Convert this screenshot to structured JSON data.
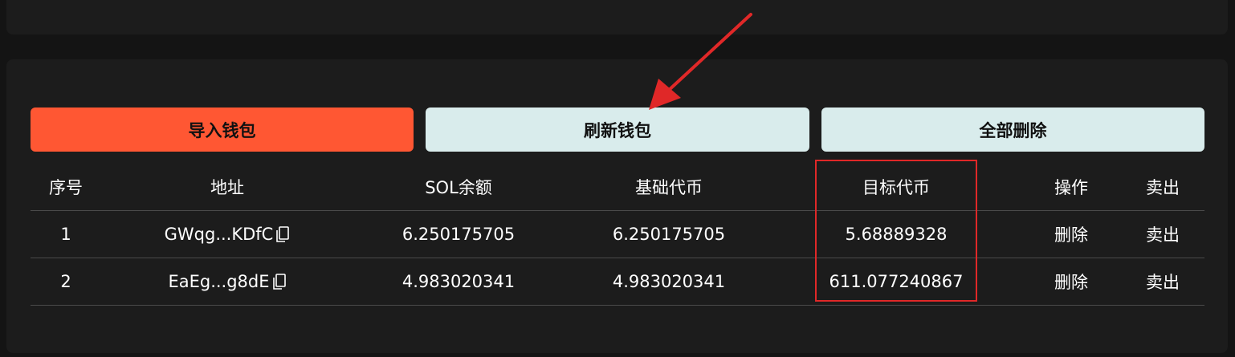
{
  "buttons": {
    "import": "导入钱包",
    "refresh": "刷新钱包",
    "delete_all": "全部删除"
  },
  "table": {
    "headers": {
      "index": "序号",
      "address": "地址",
      "sol_balance": "SOL余额",
      "base_token": "基础代币",
      "target_token": "目标代币",
      "operation": "操作",
      "sell": "卖出"
    },
    "rows": [
      {
        "index": "1",
        "address": "GWqg...KDfC",
        "sol_balance": "6.250175705",
        "base_token": "6.250175705",
        "target_token": "5.68889328",
        "delete": "删除",
        "sell": "卖出"
      },
      {
        "index": "2",
        "address": "EaEg...g8dE",
        "sol_balance": "4.983020341",
        "base_token": "4.983020341",
        "target_token": "611.077240867",
        "delete": "删除",
        "sell": "卖出"
      }
    ]
  },
  "colors": {
    "accent": "#ff5733",
    "light_button": "#d9ecec",
    "annotation": "#e02828"
  },
  "icons": [
    "copy-icon",
    "annotation-arrow"
  ]
}
